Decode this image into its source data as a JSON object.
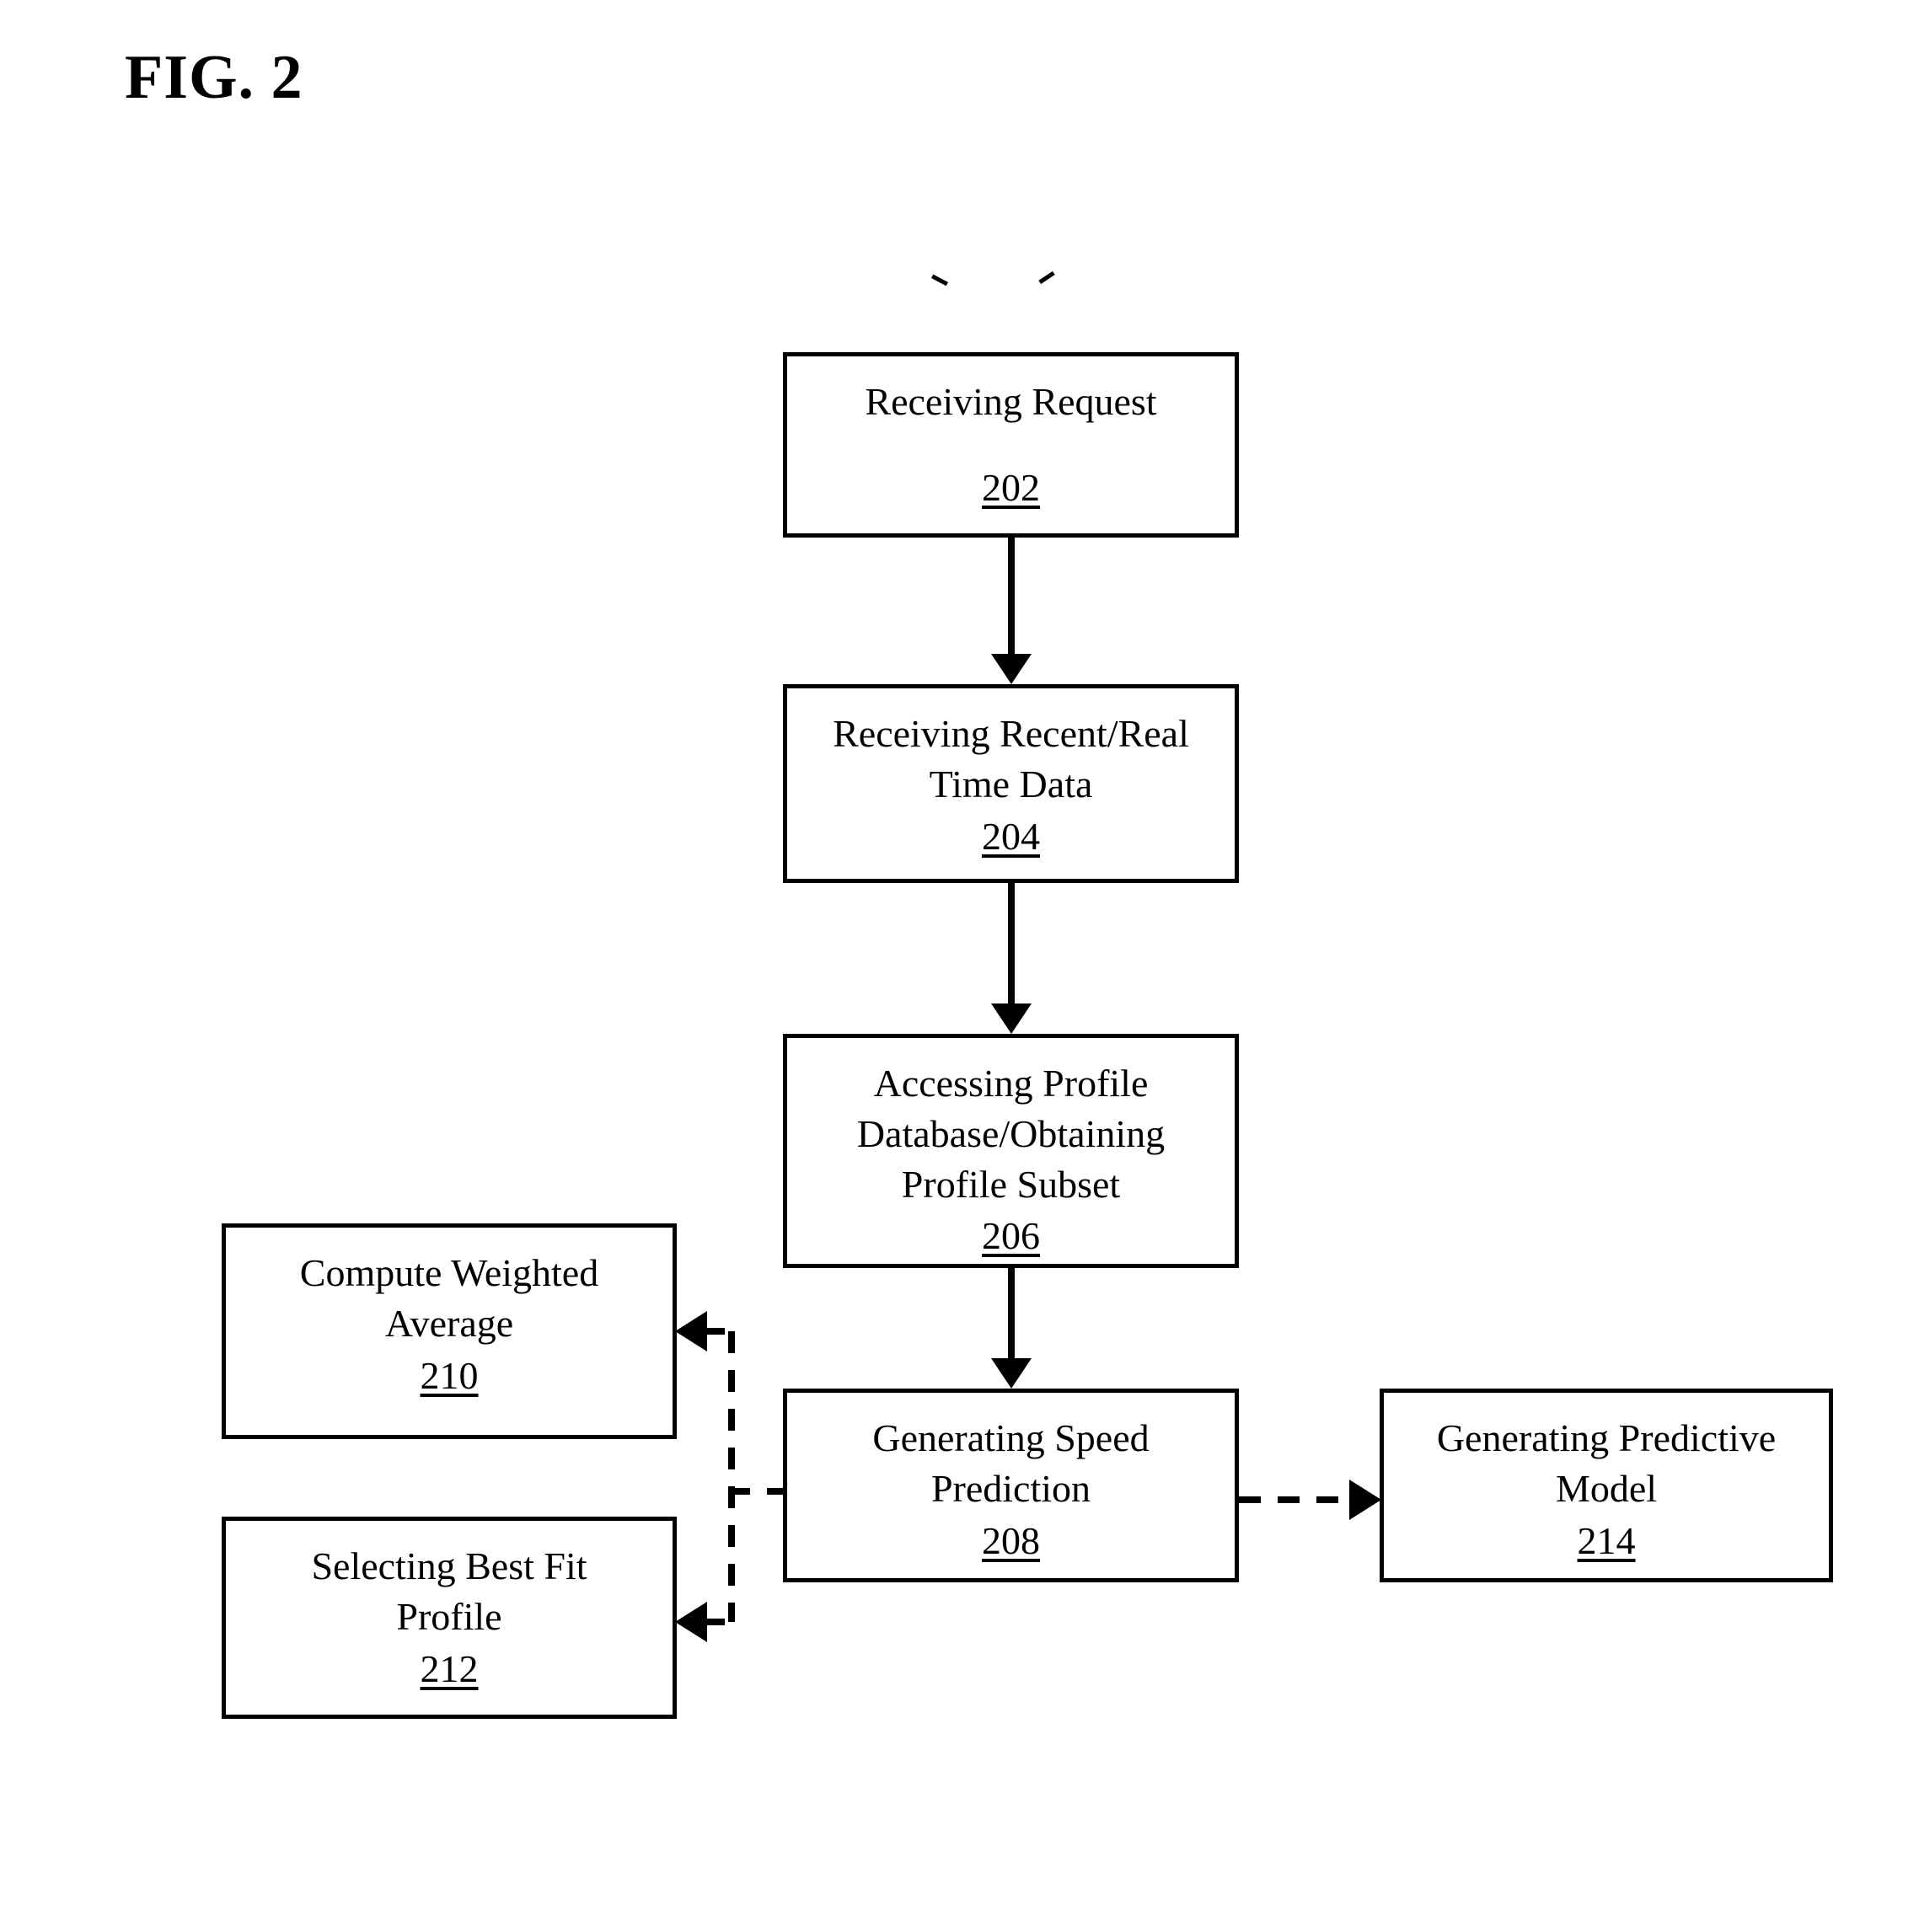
{
  "figure": {
    "title": "FIG. 2",
    "type": "patent-flowchart"
  },
  "nodes": [
    {
      "id": "202",
      "label": "Receiving Request",
      "ref": "202"
    },
    {
      "id": "204",
      "label": "Receiving Recent/Real\nTime Data",
      "ref": "204"
    },
    {
      "id": "206",
      "label": "Accessing Profile\nDatabase/Obtaining\nProfile Subset",
      "ref": "206"
    },
    {
      "id": "208",
      "label": "Generating Speed\nPrediction",
      "ref": "208"
    },
    {
      "id": "210",
      "label": "Compute Weighted\nAverage",
      "ref": "210"
    },
    {
      "id": "212",
      "label": "Selecting Best Fit\nProfile",
      "ref": "212"
    },
    {
      "id": "214",
      "label": "Generating Predictive\nModel",
      "ref": "214"
    }
  ],
  "edges": [
    {
      "from": "202",
      "to": "204",
      "style": "solid",
      "direction": "down"
    },
    {
      "from": "204",
      "to": "206",
      "style": "solid",
      "direction": "down"
    },
    {
      "from": "206",
      "to": "208",
      "style": "solid",
      "direction": "down"
    },
    {
      "from": "208",
      "to": "210",
      "style": "dashed",
      "direction": "left"
    },
    {
      "from": "208",
      "to": "212",
      "style": "dashed",
      "direction": "left"
    },
    {
      "from": "208",
      "to": "214",
      "style": "dashed",
      "direction": "right"
    }
  ],
  "colors": {
    "ink": "#000000",
    "paper": "#ffffff"
  }
}
